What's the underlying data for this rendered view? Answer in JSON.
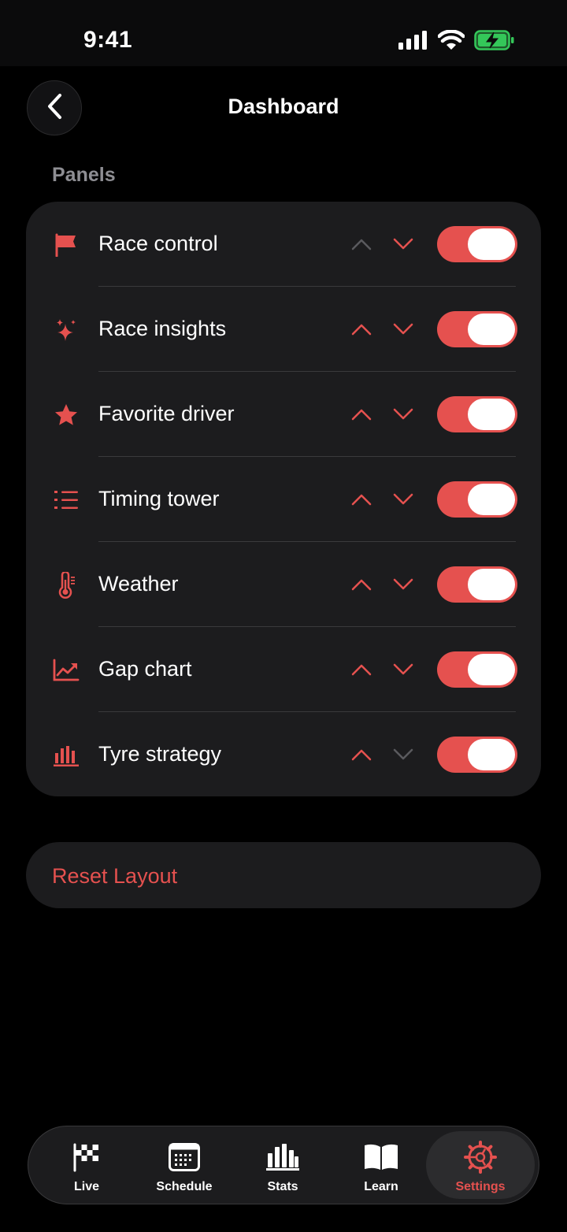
{
  "status_bar": {
    "time": "9:41",
    "icons": [
      "cellular-signal-icon",
      "wifi-icon",
      "battery-charging-icon"
    ],
    "battery_color": "#34c759"
  },
  "header": {
    "title": "Dashboard",
    "back_icon": "chevron-left-icon"
  },
  "panels_section": {
    "label": "Panels",
    "accent_color": "#e5514f",
    "items": [
      {
        "label": "Race control",
        "icon": "flag-icon",
        "enabled": true,
        "up_enabled": false,
        "down_enabled": true
      },
      {
        "label": "Race insights",
        "icon": "sparkles-icon",
        "enabled": true,
        "up_enabled": true,
        "down_enabled": true
      },
      {
        "label": "Favorite driver",
        "icon": "star-icon",
        "enabled": true,
        "up_enabled": true,
        "down_enabled": true
      },
      {
        "label": "Timing tower",
        "icon": "numbered-list-icon",
        "enabled": true,
        "up_enabled": true,
        "down_enabled": true
      },
      {
        "label": "Weather",
        "icon": "thermometer-icon",
        "enabled": true,
        "up_enabled": true,
        "down_enabled": true
      },
      {
        "label": "Gap chart",
        "icon": "line-chart-icon",
        "enabled": true,
        "up_enabled": true,
        "down_enabled": true
      },
      {
        "label": "Tyre strategy",
        "icon": "bar-chart-icon",
        "enabled": true,
        "up_enabled": true,
        "down_enabled": false
      }
    ]
  },
  "reset_button": {
    "label": "Reset Layout"
  },
  "tab_bar": {
    "active_tab": "Settings",
    "tabs": [
      {
        "label": "Live",
        "icon": "checkered-flag-icon"
      },
      {
        "label": "Schedule",
        "icon": "calendar-icon"
      },
      {
        "label": "Stats",
        "icon": "stats-bars-icon"
      },
      {
        "label": "Learn",
        "icon": "book-icon"
      },
      {
        "label": "Settings",
        "icon": "gear-icon"
      }
    ]
  }
}
